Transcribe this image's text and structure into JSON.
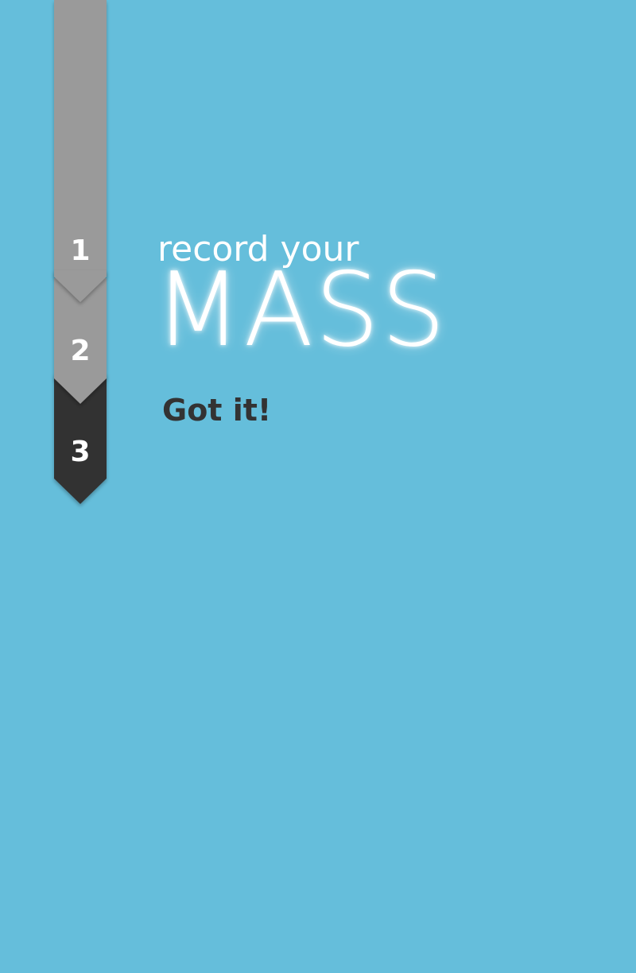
{
  "steps": [
    {
      "number": "1",
      "state": "done",
      "color": "#9a9a9a"
    },
    {
      "number": "2",
      "state": "done",
      "color": "#9a9a9a"
    },
    {
      "number": "3",
      "state": "current",
      "color": "#333333"
    }
  ],
  "headline": {
    "sub": "record your",
    "main": "MASS"
  },
  "action": {
    "got_it_label": "Got it!"
  },
  "colors": {
    "background": "#65bedb",
    "ribbon_done": "#9a9a9a",
    "ribbon_current": "#333333",
    "text_light": "#ffffff",
    "text_dark": "#333333"
  }
}
